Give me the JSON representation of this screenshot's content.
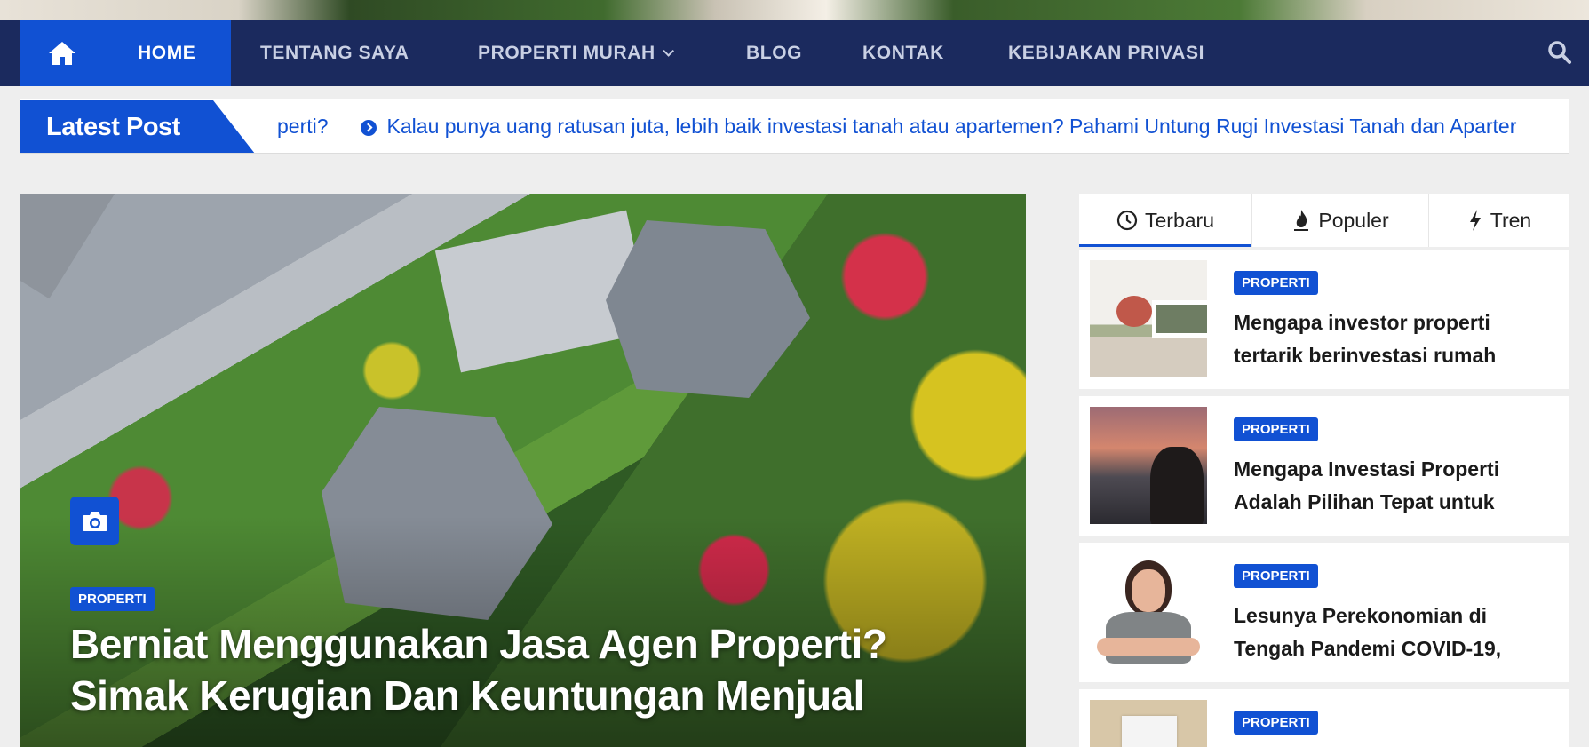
{
  "nav": {
    "items": [
      {
        "label": "HOME",
        "active": true
      },
      {
        "label": "TENTANG SAYA"
      },
      {
        "label": "PROPERTI MURAH",
        "has_dropdown": true
      },
      {
        "label": "BLOG"
      },
      {
        "label": "KONTAK"
      },
      {
        "label": "KEBIJAKAN PRIVASI"
      }
    ],
    "home_icon": "home-icon",
    "search_icon": "search-icon"
  },
  "ticker": {
    "label": "Latest Post",
    "fragment": "perti?",
    "headline": "Kalau punya uang ratusan juta, lebih baik investasi tanah atau apartemen? Pahami Untung Rugi Investasi Tanah dan Aparter"
  },
  "hero": {
    "category": "PROPERTI",
    "title": "Berniat Menggunakan Jasa Agen Properti? Simak Kerugian Dan Keuntungan Menjual",
    "camera_icon": "camera-icon"
  },
  "sidebar": {
    "tabs": [
      {
        "label": "Terbaru",
        "icon": "clock-icon",
        "active": true
      },
      {
        "label": "Populer",
        "icon": "fire-icon"
      },
      {
        "label": "Tren",
        "icon": "bolt-icon"
      }
    ],
    "posts": [
      {
        "category": "PROPERTI",
        "title": "Mengapa investor properti tertarik berinvestasi rumah"
      },
      {
        "category": "PROPERTI",
        "title": "Mengapa Investasi Properti Adalah Pilihan Tepat untuk"
      },
      {
        "category": "PROPERTI",
        "title": "Lesunya Perekonomian di Tengah Pandemi COVID-19,"
      },
      {
        "category": "PROPERTI",
        "title": ""
      }
    ]
  },
  "colors": {
    "navbar": "#1b2a5e",
    "accent": "#1151d3",
    "background": "#eeeeee"
  }
}
